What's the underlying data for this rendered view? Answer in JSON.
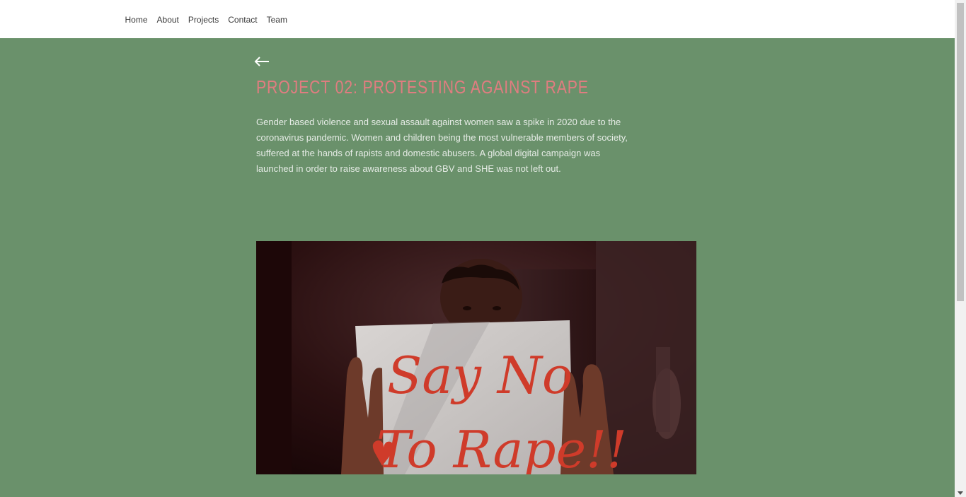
{
  "nav": {
    "items": [
      {
        "label": "Home"
      },
      {
        "label": "About"
      },
      {
        "label": "Projects"
      },
      {
        "label": "Contact"
      },
      {
        "label": "Team"
      }
    ]
  },
  "project": {
    "back_icon": "left-arrow-icon",
    "title": "PROJECT 02: PROTESTING AGAINST RAPE",
    "description": "Gender based violence and sexual assault against women saw a spike in 2020 due to the coronavirus pandemic. Women and children being the most vulnerable members of society, suffered at the hands of rapists and domestic abusers. A global digital campaign was launched in order to raise awareness about GBV and SHE was not left out.",
    "image": {
      "sign_line_1": "Say No",
      "sign_line_2": "To Rape!!"
    }
  },
  "colors": {
    "background": "#6a916b",
    "title": "#e07d80",
    "sign_text": "#cf3b2a"
  }
}
